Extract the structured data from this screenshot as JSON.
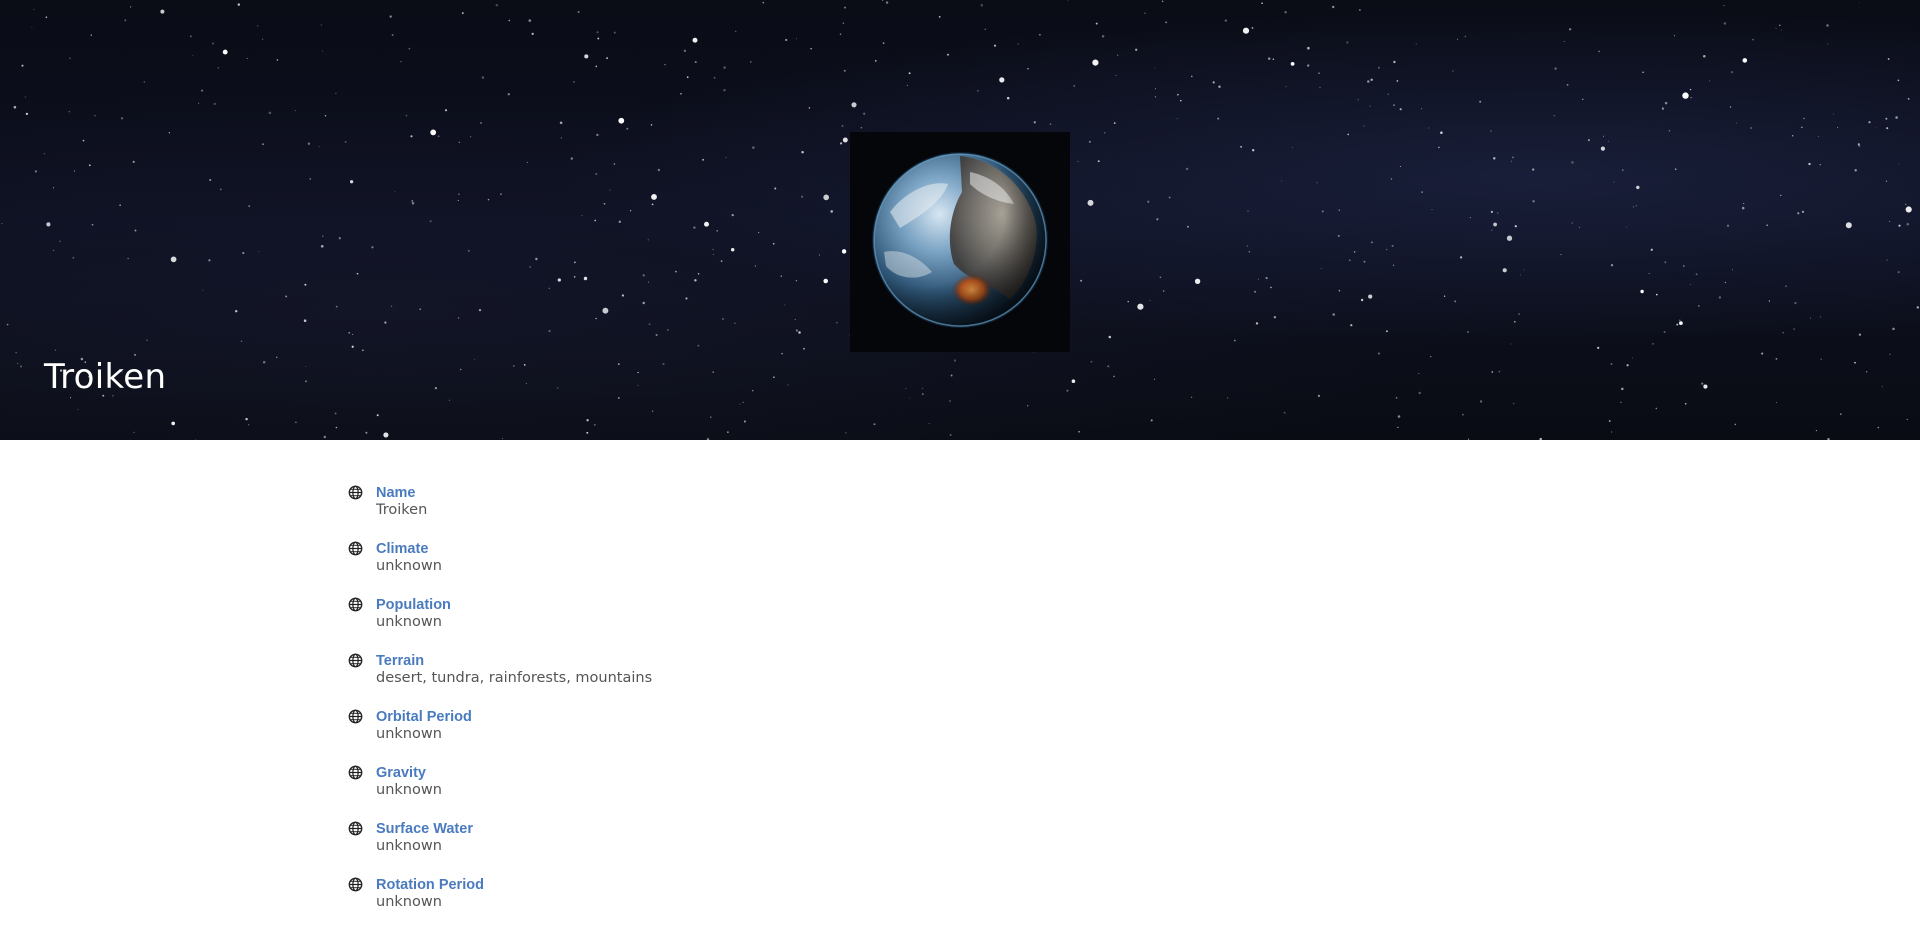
{
  "planet": {
    "title": "Troiken",
    "image_name": "planet-image"
  },
  "details": [
    {
      "label": "Name",
      "value": "Troiken",
      "icon": "globe-icon"
    },
    {
      "label": "Climate",
      "value": "unknown",
      "icon": "globe-icon"
    },
    {
      "label": "Population",
      "value": "unknown",
      "icon": "globe-icon"
    },
    {
      "label": "Terrain",
      "value": "desert, tundra, rainforests, mountains",
      "icon": "globe-icon"
    },
    {
      "label": "Orbital Period",
      "value": "unknown",
      "icon": "globe-icon"
    },
    {
      "label": "Gravity",
      "value": "unknown",
      "icon": "globe-icon"
    },
    {
      "label": "Surface Water",
      "value": "unknown",
      "icon": "globe-icon"
    },
    {
      "label": "Rotation Period",
      "value": "unknown",
      "icon": "globe-icon"
    }
  ],
  "colors": {
    "label": "#4a7bbf",
    "value": "#555555",
    "hero_background": "#0d1020",
    "title": "#ffffff"
  }
}
